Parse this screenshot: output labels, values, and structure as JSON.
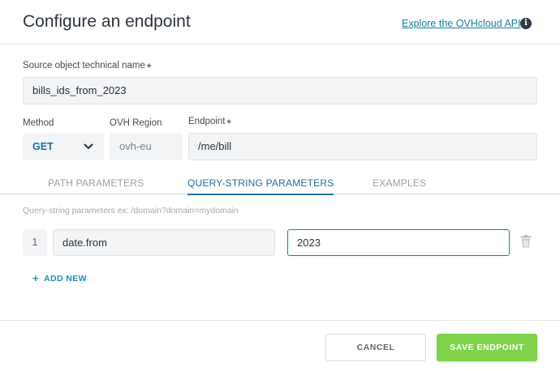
{
  "header": {
    "title": "Configure an endpoint",
    "api_link": "Explore the OVHcloud API",
    "info_glyph": "i"
  },
  "form": {
    "source_label": "Source object technical name",
    "source_value": "bills_ids_from_2023",
    "required_mark": "*",
    "method_label": "Method",
    "method_value": "GET",
    "region_label": "OVH Region",
    "region_value": "ovh-eu",
    "endpoint_label": "Endpoint",
    "endpoint_value": "/me/bill"
  },
  "tabs": [
    {
      "label": "PATH PARAMETERS",
      "active": false
    },
    {
      "label": "QUERY-STRING PARAMETERS",
      "active": true
    },
    {
      "label": "EXAMPLES",
      "active": false
    }
  ],
  "query": {
    "hint": "Query-string parameters ex: /domain?domain=mydomain",
    "rows": [
      {
        "index": "1",
        "key": "date.from",
        "value": "2023"
      }
    ],
    "add_new_label": "ADD NEW",
    "add_new_glyph": "+"
  },
  "footer": {
    "cancel_label": "CANCEL",
    "save_label": "SAVE ENDPOINT"
  },
  "icons": {
    "info": "info-icon",
    "chevron": "chevron-down-icon",
    "trash": "trash-icon",
    "plus": "plus-icon"
  },
  "colors": {
    "accent": "#1f6fa3",
    "link": "#157fa8",
    "save_button": "#7fd24a"
  }
}
